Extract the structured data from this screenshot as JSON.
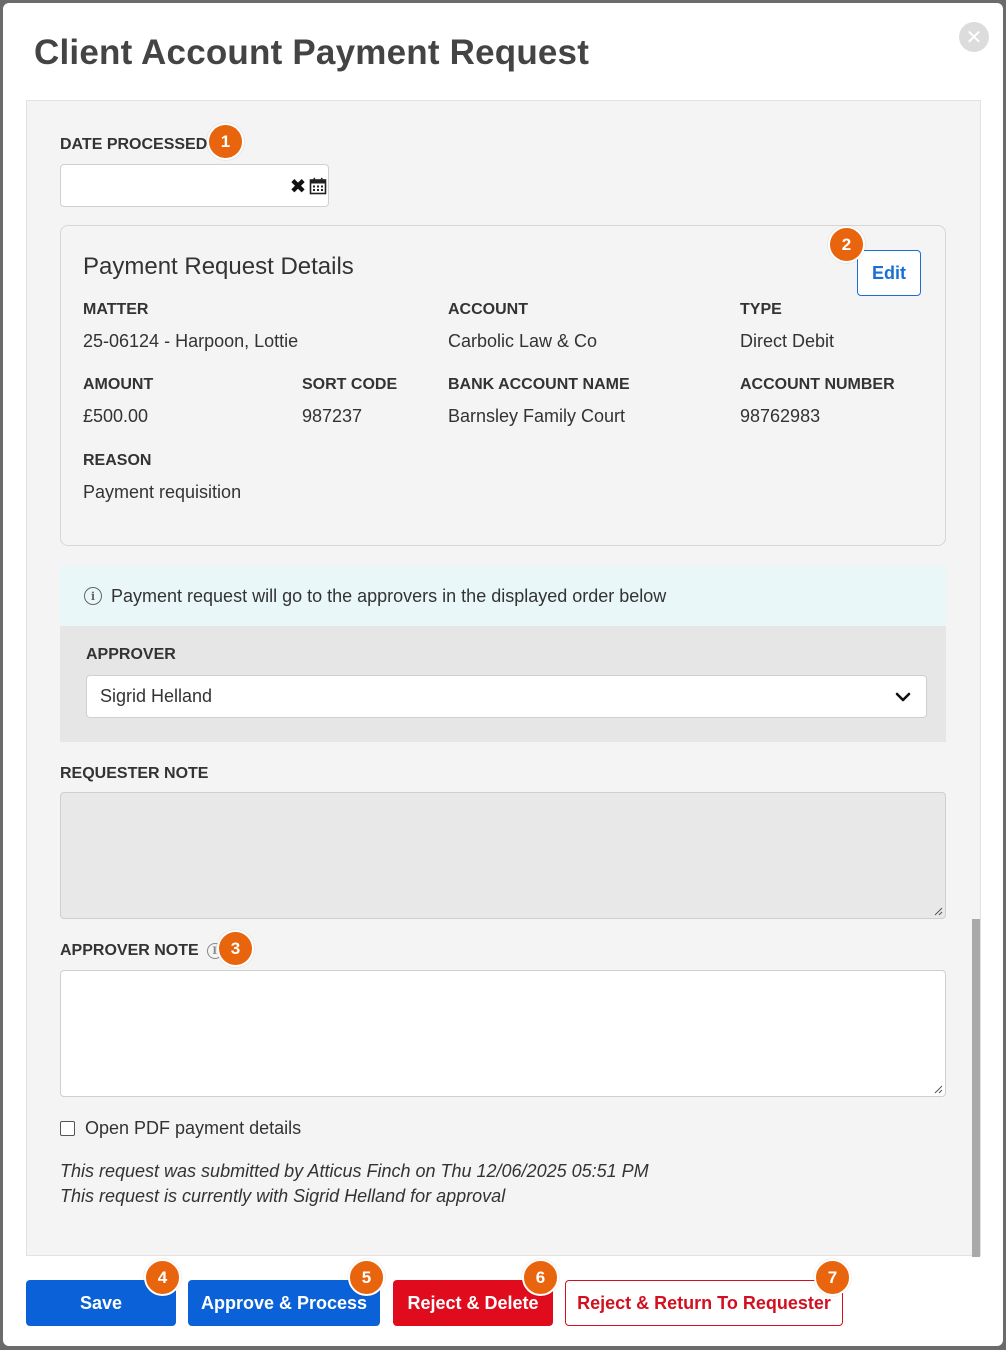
{
  "modal": {
    "title": "Client Account Payment Request",
    "close_icon": "close-icon"
  },
  "date_processed": {
    "label": "DATE PROCESSED",
    "value": "",
    "clear_glyph": "✖",
    "badge": "1"
  },
  "details": {
    "title": "Payment Request Details",
    "edit_label": "Edit",
    "badge": "2",
    "fields": {
      "matter": {
        "label": "MATTER",
        "value": "25-06124 - Harpoon, Lottie"
      },
      "account": {
        "label": "ACCOUNT",
        "value": "Carbolic Law & Co"
      },
      "type": {
        "label": "TYPE",
        "value": "Direct Debit"
      },
      "amount": {
        "label": "AMOUNT",
        "value": "£500.00"
      },
      "sort_code": {
        "label": "SORT CODE",
        "value": "987237"
      },
      "bank_account_name": {
        "label": "BANK ACCOUNT NAME",
        "value": "Barnsley Family Court"
      },
      "account_number": {
        "label": "ACCOUNT NUMBER",
        "value": "98762983"
      },
      "reason": {
        "label": "REASON",
        "value": "Payment requisition"
      }
    }
  },
  "info_banner": {
    "text": "Payment request will go to the approvers in the displayed order below",
    "icon_glyph": "i"
  },
  "approver": {
    "label": "APPROVER",
    "selected": "Sigrid Helland"
  },
  "requester_note": {
    "label": "REQUESTER NOTE",
    "value": ""
  },
  "approver_note": {
    "label": "APPROVER NOTE",
    "value": "",
    "badge": "3",
    "info_glyph": "i"
  },
  "open_pdf": {
    "label": "Open PDF payment details",
    "checked": false
  },
  "footnotes": {
    "submitted": "This request was submitted by Atticus Finch on Thu 12/06/2025 05:51 PM",
    "current": "This request is currently with Sigrid Helland for approval"
  },
  "buttons": {
    "save": {
      "label": "Save",
      "badge": "4"
    },
    "approve": {
      "label": "Approve & Process",
      "badge": "5"
    },
    "reject_delete": {
      "label": "Reject & Delete",
      "badge": "6"
    },
    "reject_return": {
      "label": "Reject & Return To Requester",
      "badge": "7"
    }
  },
  "colors": {
    "primary_blue": "#0b62d8",
    "danger_red": "#e00b1c",
    "badge_orange": "#e8650e",
    "info_bg": "#eaf7f8"
  }
}
